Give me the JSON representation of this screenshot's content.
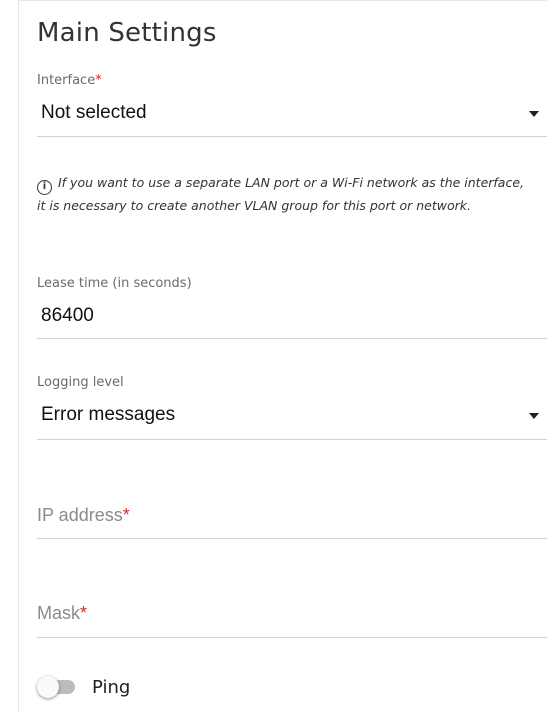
{
  "section": {
    "title": "Main Settings"
  },
  "interface_field": {
    "label": "Interface",
    "required_mark": "*",
    "value": "Not selected"
  },
  "info_note": {
    "icon": "info-icon",
    "text": "If you want to use a separate LAN port or a Wi-Fi network as the interface, it is necessary to create another VLAN group for this port or network."
  },
  "lease_time_field": {
    "label": "Lease time (in seconds)",
    "value": "86400"
  },
  "logging_field": {
    "label": "Logging level",
    "value": "Error messages"
  },
  "ip_address_field": {
    "placeholder": "IP address",
    "required_mark": "*"
  },
  "mask_field": {
    "placeholder": "Mask",
    "required_mark": "*"
  },
  "ping_toggle": {
    "label": "Ping",
    "state": "off"
  },
  "colors": {
    "required": "#d42b2b",
    "underline": "#d0d0d0",
    "toggle_track_off": "#bdbdbd"
  }
}
